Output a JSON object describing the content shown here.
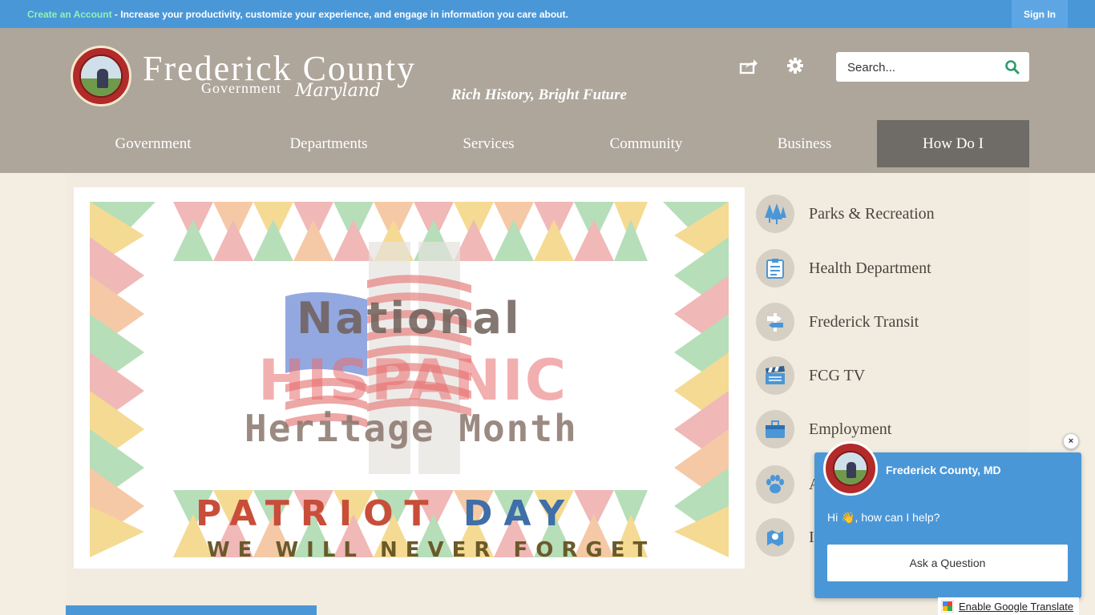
{
  "topbar": {
    "create_account": "Create an Account",
    "message": " - Increase your productivity, customize your experience, and engage in information you care about.",
    "sign_in": "Sign In"
  },
  "brand": {
    "title": "Frederick County",
    "government": "Government",
    "maryland": "Maryland",
    "tagline": "Rich History, Bright Future"
  },
  "search": {
    "placeholder": "Search..."
  },
  "nav": [
    {
      "label": "Government"
    },
    {
      "label": "Departments"
    },
    {
      "label": "Services"
    },
    {
      "label": "Community"
    },
    {
      "label": "Business"
    },
    {
      "label": "How Do I",
      "active": true
    }
  ],
  "slide": {
    "line1": "National",
    "line2": "HISPANIC",
    "line3": "Heritage Month",
    "patriot_a": "PATRIOT ",
    "patriot_b": "DAY",
    "never": "WE WILL NEVER FORGET"
  },
  "quick_links": [
    {
      "label": "Parks & Recreation",
      "icon": "trees-icon"
    },
    {
      "label": "Health Department",
      "icon": "clipboard-icon"
    },
    {
      "label": "Frederick Transit",
      "icon": "signpost-icon"
    },
    {
      "label": "FCG TV",
      "icon": "clapperboard-icon"
    },
    {
      "label": "Employment",
      "icon": "briefcase-icon"
    },
    {
      "label": "A",
      "icon": "paw-icon"
    },
    {
      "label": "I",
      "icon": "map-pin-icon"
    }
  ],
  "chat": {
    "title": "Frederick County, MD",
    "message": "Hi 👋, how can I help?",
    "button": "Ask a Question",
    "close": "×"
  },
  "translate": {
    "label": "Enable Google Translate"
  },
  "colors": {
    "topbar": "#4a97d8",
    "header": "#aea59b",
    "nav_active": "#6f6b66",
    "page_bg": "#f3ede2",
    "accent_green": "#8ff3b4"
  }
}
